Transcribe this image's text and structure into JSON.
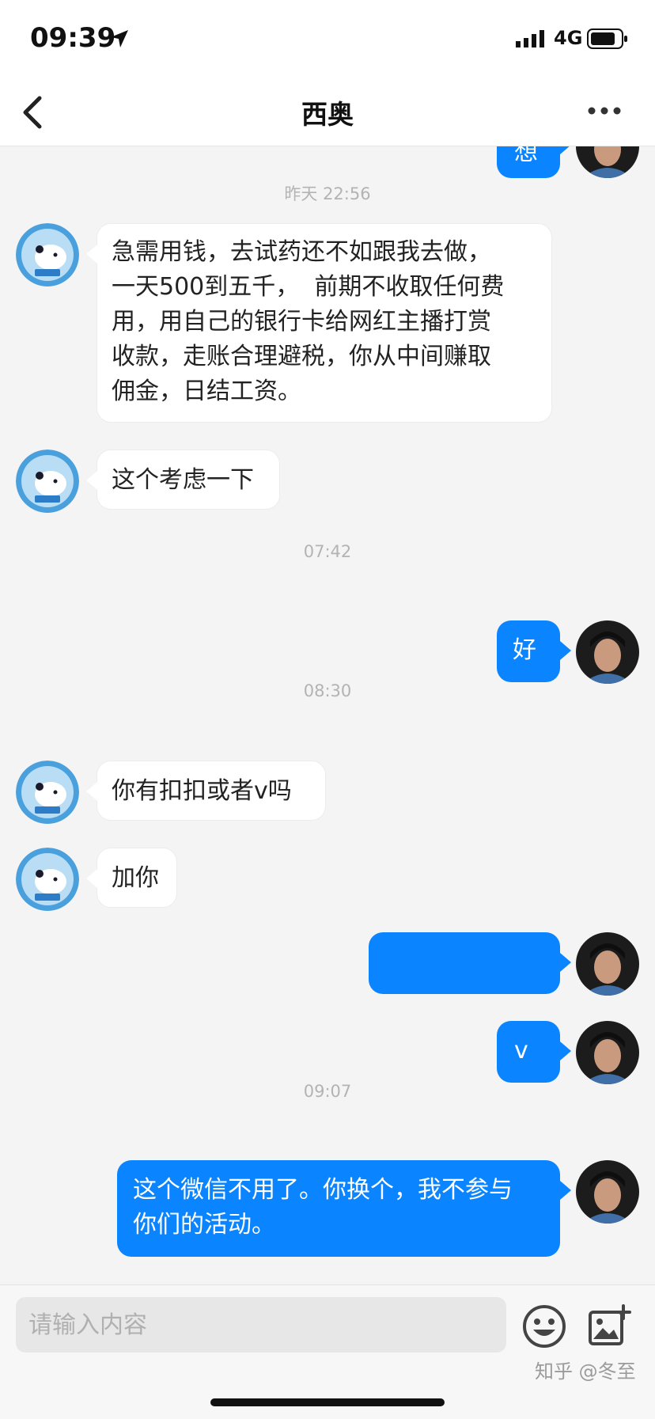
{
  "status_bar": {
    "time": "09:39",
    "network": "4G"
  },
  "nav": {
    "title": "西奥"
  },
  "partial_top_message": {
    "text": "想"
  },
  "messages": [
    {
      "id": "ts1",
      "text": "昨天 22:56"
    },
    {
      "id": "m1",
      "text": "急需用钱，去试药还不如跟我去做，\n一天500到五千，  前期不收取任何费\n用，用自己的银行卡给网红主播打赏\n收款，走账合理避税，你从中间赚取\n佣金，日结工资。"
    },
    {
      "id": "m2",
      "text": "这个考虑一下"
    },
    {
      "id": "ts2",
      "text": "07:42"
    },
    {
      "id": "m3",
      "text": "好"
    },
    {
      "id": "ts3",
      "text": "08:30"
    },
    {
      "id": "m4",
      "text": "你有扣扣或者v吗"
    },
    {
      "id": "m5",
      "text": "加你"
    },
    {
      "id": "m6",
      "text": ""
    },
    {
      "id": "m7",
      "text": "v"
    },
    {
      "id": "ts4",
      "text": "09:07"
    },
    {
      "id": "m8",
      "text": "这个微信不用了。你换个，我不参与\n你们的活动。"
    }
  ],
  "input": {
    "placeholder": "请输入内容"
  },
  "watermark": "知乎 @冬至",
  "colors": {
    "outgoing_bubble": "#0a84ff",
    "incoming_bubble": "#ffffff",
    "background": "#f4f4f4"
  }
}
